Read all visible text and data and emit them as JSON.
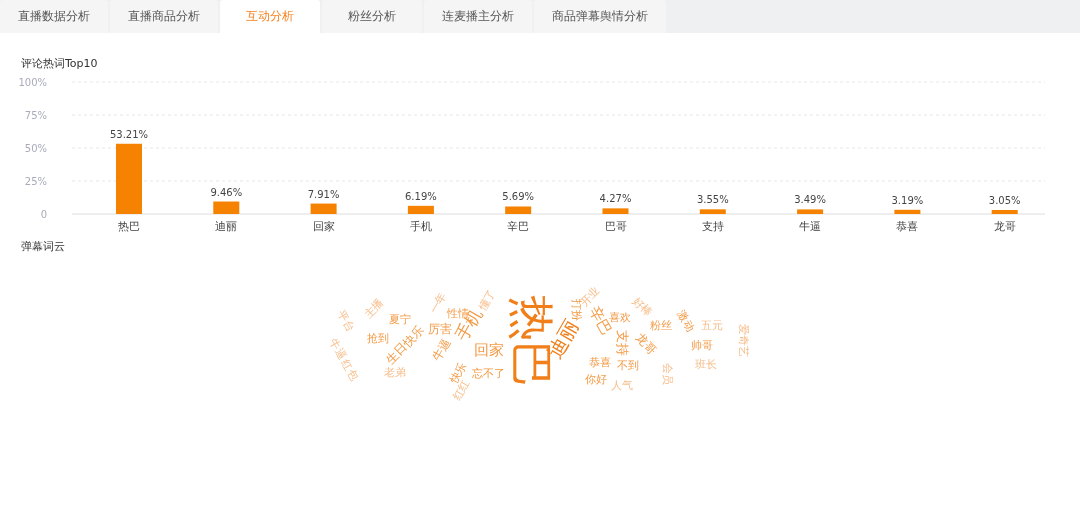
{
  "tabs": [
    {
      "label": "直播数据分析",
      "selected": false
    },
    {
      "label": "直播商品分析",
      "selected": false
    },
    {
      "label": "互动分析",
      "selected": true
    },
    {
      "label": "粉丝分析",
      "selected": false
    },
    {
      "label": "连麦播主分析",
      "selected": false
    },
    {
      "label": "商品弹幕舆情分析",
      "selected": false
    }
  ],
  "top_words": {
    "title": "评论热词Top10",
    "chart_data": {
      "type": "bar",
      "categories": [
        "热巴",
        "迪丽",
        "回家",
        "手机",
        "辛巴",
        "巴哥",
        "支持",
        "牛逼",
        "恭喜",
        "龙哥"
      ],
      "grid": true,
      "series": [
        {
          "color": "#f58200",
          "values": [
            53.21,
            9.46,
            7.91,
            6.19,
            5.69,
            4.27,
            3.55,
            3.49,
            3.19,
            3.05
          ]
        }
      ],
      "ylim": [
        0,
        100
      ],
      "yticks": [
        {
          "value": 0,
          "label": "0"
        },
        {
          "value": 25,
          "label": "25%"
        },
        {
          "value": 50,
          "label": "50%"
        },
        {
          "value": 75,
          "label": "75%"
        },
        {
          "value": 100,
          "label": "100%"
        }
      ],
      "value_labels": [
        "53.21%",
        "9.46%",
        "7.91%",
        "6.19%",
        "5.69%",
        "4.27%",
        "3.55%",
        "3.49%",
        "3.19%",
        "3.05%"
      ]
    }
  },
  "word_cloud": {
    "title": "弹幕词云",
    "words": [
      "热巴",
      "迪丽",
      "手机",
      "回家",
      "辛巴",
      "支持",
      "龙哥",
      "恭喜",
      "不到",
      "喜欢",
      "你好",
      "人气",
      "粉丝",
      "五元",
      "帅哥",
      "班长",
      "打扮",
      "开业",
      "激动",
      "会员",
      "夏宁",
      "性情",
      "厉害",
      "生日快乐",
      "抢到",
      "牛逼",
      "牛逼",
      "老弟",
      "快乐",
      "忘不了",
      "红红",
      "红包",
      "主播",
      "平台",
      "一年",
      "懂了",
      "爱奇艺",
      "好棒"
    ]
  }
}
